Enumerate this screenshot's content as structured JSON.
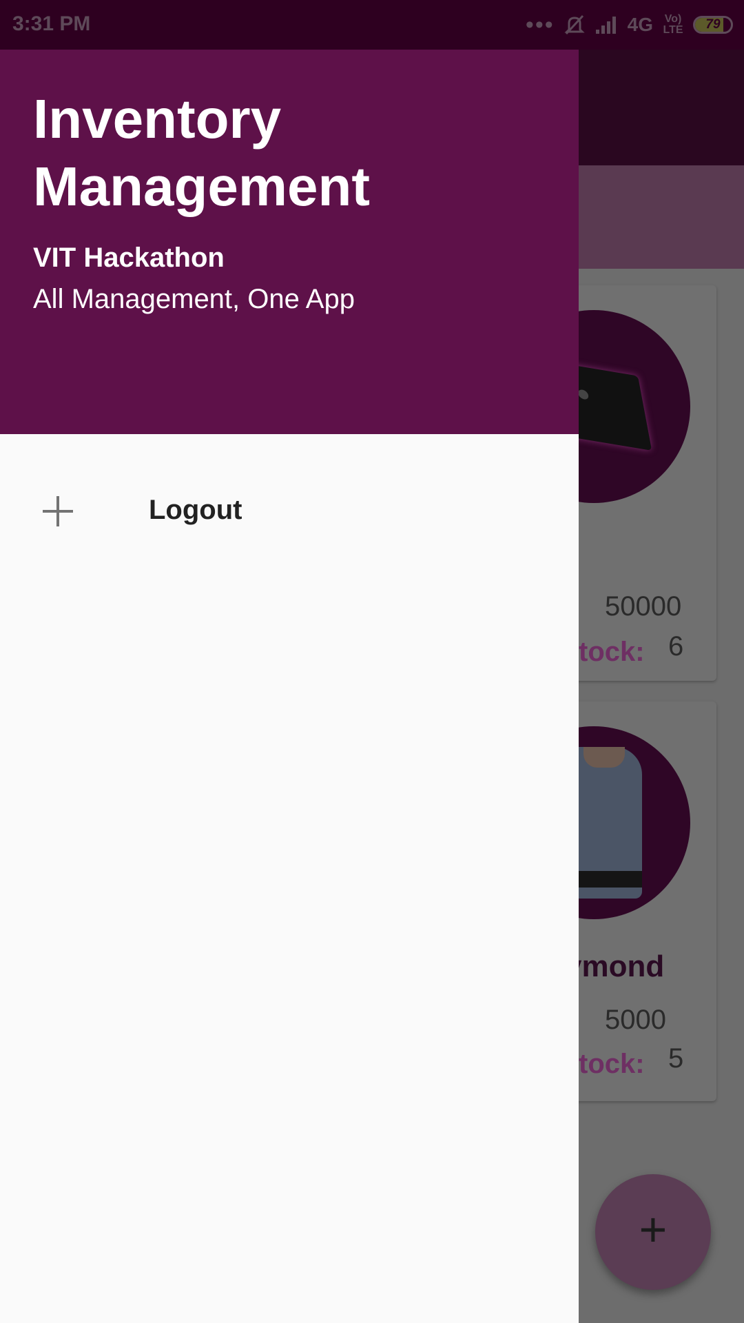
{
  "status_bar": {
    "time": "3:31 PM",
    "network": "4G",
    "lte_label": "Vo) LTE",
    "battery_level": 79,
    "battery_text": "79",
    "icons": [
      "overflow-dots-icon",
      "silent-bell-icon",
      "signal-icon",
      "battery-icon"
    ]
  },
  "drawer": {
    "title": "Inventory Management",
    "subtitle": "VIT Hackathon",
    "tagline": "All Management, One App",
    "items": [
      {
        "label": "Logout",
        "icon": "plus-icon"
      }
    ],
    "header_color": "#5e1149"
  },
  "background_list": {
    "items": [
      {
        "name": "",
        "price_label": ":",
        "price": "50000",
        "stock_label": "tock:",
        "stock": "6",
        "image": "laptop"
      },
      {
        "name": "ymond",
        "price_label": ":",
        "price": "5000",
        "stock_label": "tock:",
        "stock": "5",
        "image": "shirt"
      }
    ],
    "fab_label": "+"
  }
}
